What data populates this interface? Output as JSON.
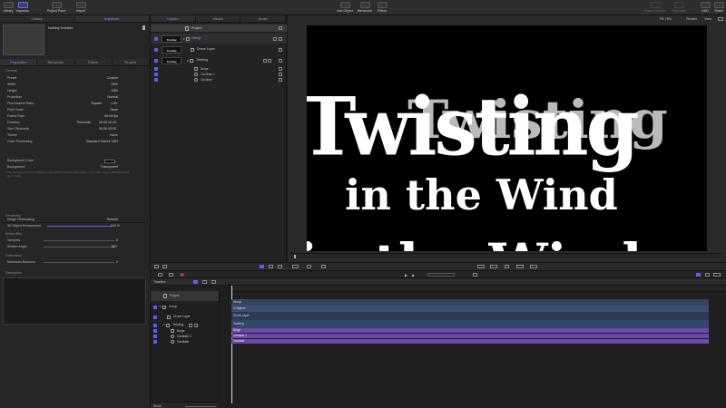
{
  "toolbar": {
    "left_buttons": [
      "Library",
      "Inspector",
      "Project Pane",
      "Import"
    ],
    "center_buttons": [
      "Add Object",
      "Behaviors",
      "Filters"
    ],
    "right_buttons": [
      "Make Particles",
      "Replicate",
      "HUD",
      "Share"
    ]
  },
  "left_panel": {
    "tabs": [
      "Library",
      "Inspector"
    ],
    "selection": "Nothing Selected",
    "subtabs": [
      "Properties",
      "Behaviors",
      "Filters",
      "Project"
    ],
    "general_header": "General",
    "properties": [
      {
        "label": "Preset",
        "value": "Custom"
      },
      {
        "label": "Width",
        "value": "1920"
      },
      {
        "label": "Height",
        "value": "1080"
      },
      {
        "label": "Projection",
        "value": "Normal"
      },
      {
        "label": "Pixel Aspect Ratio",
        "value": "Square",
        "extra": "1.00"
      },
      {
        "label": "Field Order",
        "value": "None"
      },
      {
        "label": "Frame Rate",
        "value": "60.00 fps"
      },
      {
        "label": "Duration",
        "value": "Timecode",
        "extra": "00:00:10:00"
      },
      {
        "label": "Start Timecode",
        "value": "00:00:00:00"
      },
      {
        "label": "Theme",
        "value": "None"
      },
      {
        "label": "Color Processing",
        "value": "Standard Gamut SDR"
      }
    ],
    "background_color_label": "Background Color",
    "background_label": "Background",
    "background_value": "Transparent",
    "background_note": "The background color is visible in the canvas, but does not render in the output unless Background is set to Solid.",
    "rendering_header": "Rendering",
    "image_overscaling_label": "Image Overscaling",
    "image_overscaling_value": "Smooth",
    "env_label": "3D Object Environment",
    "env_value": "100 %",
    "motion_blur_header": "Motion Blur",
    "samples_label": "Samples",
    "samples_value": "8",
    "shutter_label": "Shutter Angle",
    "shutter_value": "360°",
    "reflections_header": "Reflections",
    "bounces_label": "Maximum Bounces",
    "bounces_value": "2",
    "description_header": "Description"
  },
  "layers_panel": {
    "tabs": [
      "Layers",
      "Media",
      "Audio"
    ],
    "project_label": "Project",
    "layers": [
      {
        "name": "Group",
        "thumb": "Twisting"
      },
      {
        "name": "Drone Layer",
        "thumb": "Twisting"
      },
      {
        "name": "Twisting",
        "thumb": "Twisting"
      }
    ],
    "behaviors": [
      "Bulge",
      "Oscillate 1",
      "Oscillate"
    ]
  },
  "canvas": {
    "fit_label": "Fit:",
    "fit_value": "75%",
    "render_label": "Render",
    "view_label": "View",
    "line1": "Twisting",
    "line1_back": "Twisting",
    "line2": "in the Wind",
    "line3": "in the Wind"
  },
  "timeline": {
    "title": "Timeline",
    "rows": [
      "Project",
      "Group",
      "Drone Layer",
      "Twisting",
      "Bulge",
      "Oscillate 1",
      "Oscillate"
    ],
    "bars": [
      "Group",
      "3 Objects",
      "Drone Layer",
      "Twisting",
      "Bulge",
      "Oscillate 1",
      "Oscillate"
    ],
    "footer_label": "Small"
  },
  "colors": {
    "accent": "#6d6ff0",
    "canvas_bg": "#000000",
    "bar_blue": "#3d4d6e",
    "bar_purple": "#6a4aa8"
  }
}
